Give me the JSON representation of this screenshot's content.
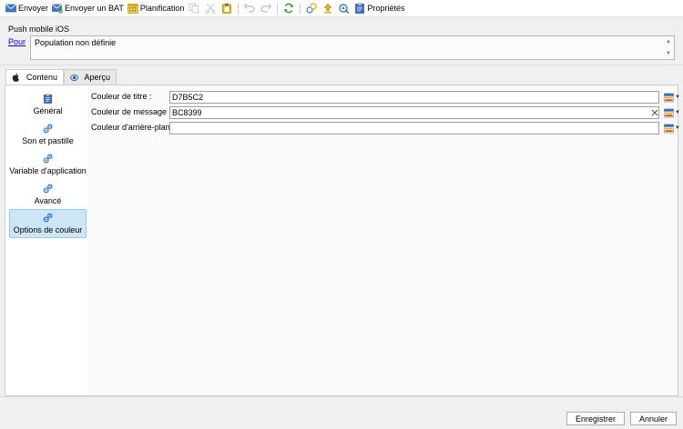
{
  "toolbar": {
    "envoyer": "Envoyer",
    "envoyer_bat": "Envoyer un BAT",
    "planification": "Planification",
    "proprietes": "Propriétés",
    "icons": [
      "send-icon",
      "send-bat-icon",
      "calendar-icon",
      "copy-icon",
      "cut-icon",
      "paste-icon",
      "undo-icon",
      "redo-icon",
      "refresh-icon",
      "link-icon",
      "upload-icon",
      "tools-icon",
      "clipboard-icon"
    ]
  },
  "push": {
    "title": "Push mobile iOS",
    "pour_link": "Pour",
    "target_value": "Population non définie"
  },
  "tabs": [
    {
      "label": "Contenu",
      "icon": "apple-icon",
      "active": true
    },
    {
      "label": "Aperçu",
      "icon": "eye-icon",
      "active": false
    }
  ],
  "nav": [
    {
      "label": "Général",
      "icon": "clipboard-icon"
    },
    {
      "label": "Son et pastille",
      "icon": "gear-icon"
    },
    {
      "label": "Variable d'application",
      "icon": "gear-icon"
    },
    {
      "label": "Avancé",
      "icon": "gear-icon"
    },
    {
      "label": "Options de couleur",
      "icon": "gear-icon",
      "active": true
    }
  ],
  "fields": [
    {
      "label": "Couleur de titre :",
      "value": "D7B5C2"
    },
    {
      "label": "Couleur de message :",
      "value": "BC8399"
    },
    {
      "label": "Couleur d'arrière-plan :",
      "value": ""
    }
  ],
  "buttons": {
    "save": "Enregistrer",
    "cancel": "Annuler"
  },
  "colors": {
    "accent": "#0b62c2",
    "active_nav_bg": "#cde6f7",
    "link": "#0000cc",
    "refresh_green": "#2d9b2d",
    "paste_yellow": "#e3b21b"
  }
}
